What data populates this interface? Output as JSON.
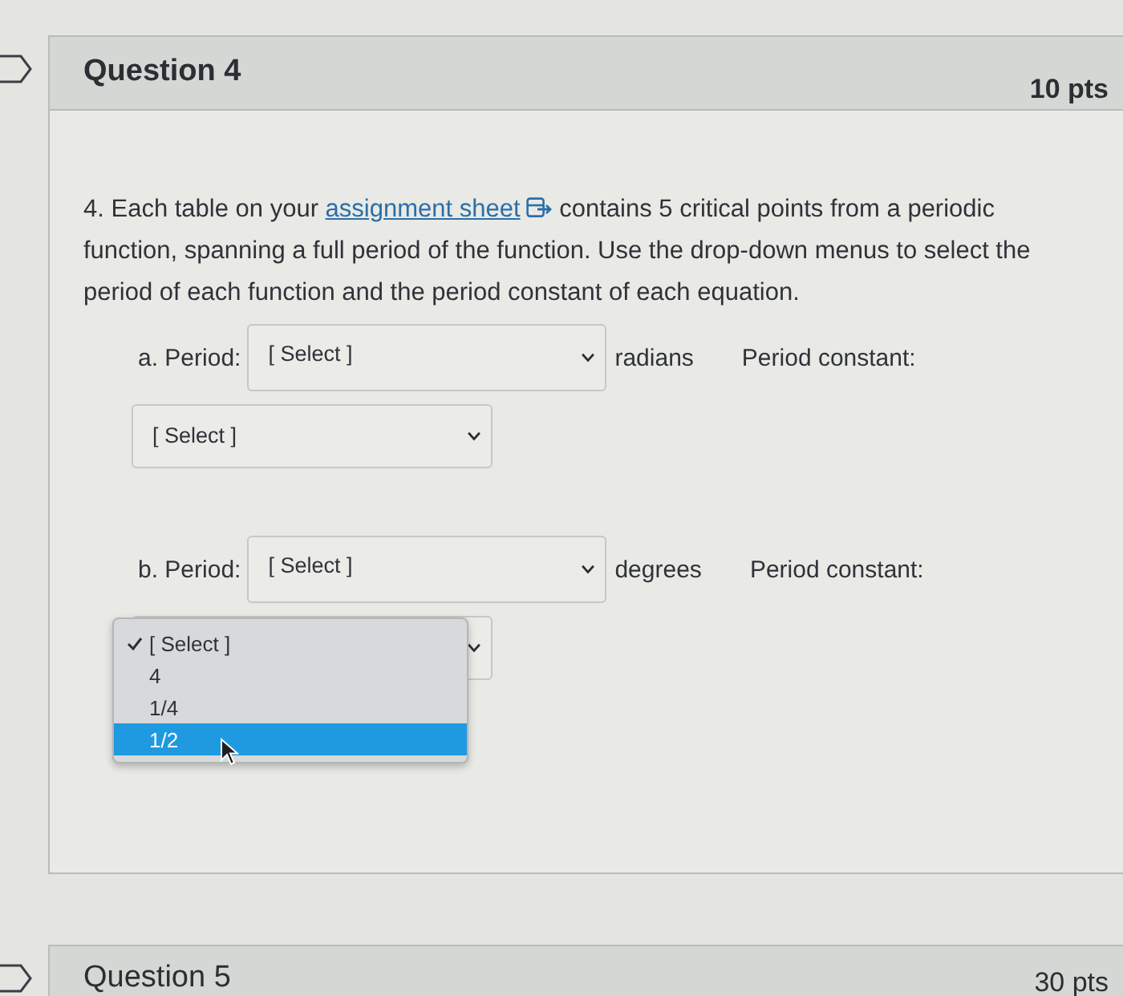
{
  "question": {
    "title": "Question 4",
    "points": "10 pts"
  },
  "prompt": {
    "before": "4. Each table on your",
    "link": "assignment sheet",
    "after": "contains 5 critical points from a periodic function, spanning a full period of the function. Use the drop-down menus to select the period of each function and the period constant of each equation."
  },
  "parts": [
    {
      "label": "a. Period:",
      "period_select": {
        "value": "[ Select ]"
      },
      "unit": "radians",
      "constant_label": "Period constant:",
      "constant_select": {
        "value": "[ Select ]",
        "expanded": false
      }
    },
    {
      "label": "b. Period:",
      "period_select": {
        "value": "[ Select ]"
      },
      "unit": "degrees",
      "constant_label": "Period constant:",
      "constant_select": {
        "expanded": true,
        "options": [
          {
            "label": "[ Select ]",
            "selected": true,
            "highlighted": false
          },
          {
            "label": "4",
            "selected": false,
            "highlighted": false
          },
          {
            "label": "1/4",
            "selected": false,
            "highlighted": false
          },
          {
            "label": "1/2",
            "selected": false,
            "highlighted": true
          }
        ]
      }
    }
  ],
  "next_question": {
    "title": "Question 5",
    "points": "30 pts"
  }
}
